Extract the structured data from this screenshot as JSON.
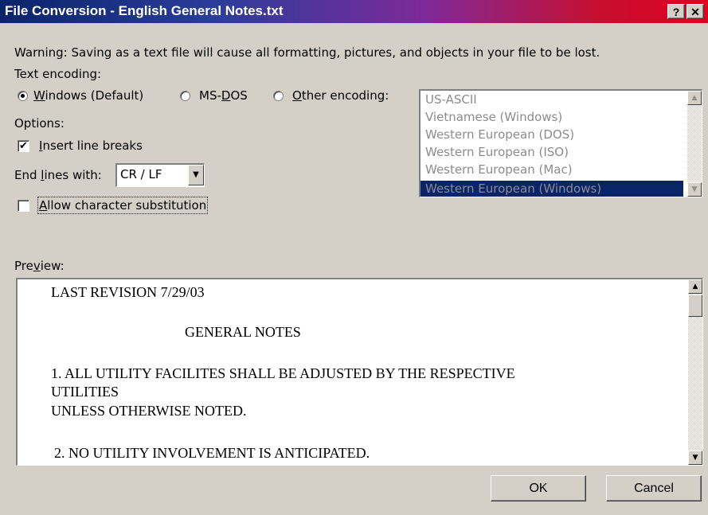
{
  "window": {
    "title": "File Conversion - English General Notes.txt",
    "help_button": "?",
    "close_button": "✕"
  },
  "warning": "Warning: Saving as a text file will cause all formatting, pictures, and objects in your file to be lost.",
  "encoding": {
    "label": "Text encoding:",
    "options": [
      {
        "pre": "",
        "key": "W",
        "post": "indows (Default)",
        "selected": true
      },
      {
        "pre": "MS-",
        "key": "D",
        "post": "OS",
        "selected": false
      },
      {
        "pre": "",
        "key": "O",
        "post": "ther encoding:",
        "selected": false
      }
    ],
    "list": [
      "US-ASCII",
      "Vietnamese (Windows)",
      "Western European (DOS)",
      "Western European (ISO)",
      "Western European (Mac)",
      "Western European (Windows)"
    ],
    "list_selected_index": 5
  },
  "options": {
    "label": "Options:",
    "insert_line_breaks": {
      "key": "I",
      "rest": "nsert line breaks",
      "checked": true
    },
    "end_lines": {
      "pre": "End ",
      "key": "l",
      "post": "ines with:",
      "value": "CR / LF"
    },
    "allow_substitution": {
      "key": "A",
      "rest": "llow character substitution",
      "checked": false
    }
  },
  "preview": {
    "label_pre": "Pre",
    "label_key": "v",
    "label_post": "iew:",
    "lines": [
      "LAST REVISION 7/29/03",
      "GENERAL NOTES",
      "1. ALL UTILITY FACILITES SHALL BE ADJUSTED BY THE RESPECTIVE",
      "UTILITIES",
      "UNLESS OTHERWISE NOTED.",
      "2. NO UTILITY INVOLVEMENT IS ANTICIPATED."
    ]
  },
  "buttons": {
    "ok": "OK",
    "cancel": "Cancel"
  },
  "icons": {
    "up": "▲",
    "down": "▼",
    "check": "✔"
  },
  "colors": {
    "selection": "#0a246a",
    "disabled_text": "#8c8c8c",
    "dialog_bg": "#d4d0c8"
  }
}
